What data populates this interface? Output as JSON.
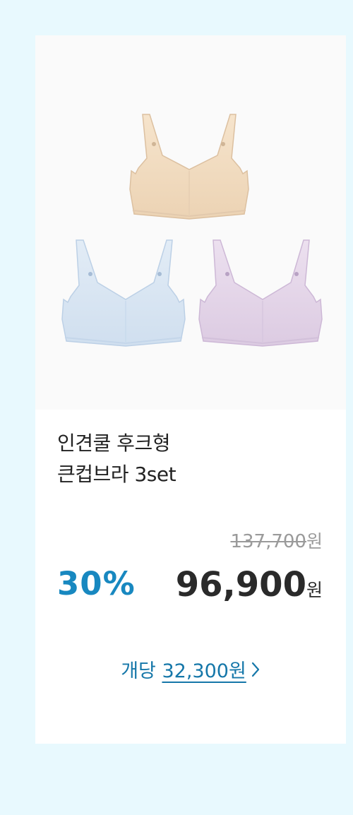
{
  "product": {
    "title_line1": "인견쿨 후크형",
    "title_line2": "큰컵브라 3set",
    "image_colors": {
      "top": "#f3dcc0",
      "left": "#d9e6f3",
      "right": "#e6d7ea"
    }
  },
  "pricing": {
    "original_price": "137,700",
    "original_unit": "원",
    "discount": "30%",
    "price": "96,900",
    "price_unit": "원"
  },
  "per_unit": {
    "prefix": "개당",
    "amount": "32,300원",
    "icon": "chevron-right-icon"
  },
  "colors": {
    "background": "#e8f9fe",
    "accent": "#1888c0",
    "link": "#1577a9"
  }
}
